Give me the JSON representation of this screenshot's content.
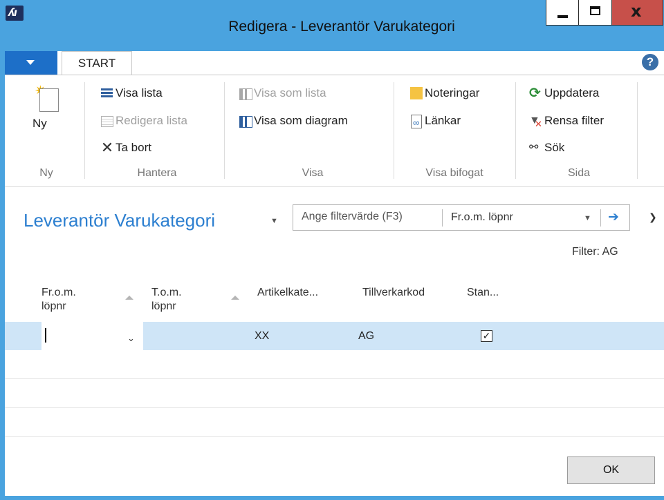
{
  "window": {
    "title": "Redigera - Leverantör Varukategori",
    "icons": [
      "app-logo-icon",
      "minimize-icon",
      "maximize-icon",
      "close-icon"
    ]
  },
  "ribbon": {
    "tab_start": "START",
    "groups": {
      "ny": {
        "label": "Ny",
        "new_label": "Ny"
      },
      "hantera": {
        "label": "Hantera",
        "visa_lista": "Visa lista",
        "redigera_lista": "Redigera lista",
        "ta_bort": "Ta bort"
      },
      "visa": {
        "label": "Visa",
        "visa_som_lista": "Visa som lista",
        "visa_som_diagram": "Visa som diagram"
      },
      "visa_bifogat": {
        "label": "Visa bifogat",
        "noteringar": "Noteringar",
        "lankar": "Länkar"
      },
      "sida": {
        "label": "Sida",
        "uppdatera": "Uppdatera",
        "rensa_filter": "Rensa filter",
        "sok": "Sök"
      }
    }
  },
  "page": {
    "title": "Leverantör Varukategori",
    "filter_placeholder": "Ange filtervärde (F3)",
    "filter_field": "Fr.o.m. löpnr",
    "filter_status": "Filter: AG"
  },
  "grid": {
    "headers": {
      "from_nr_1": "Fr.o.m.",
      "from_nr_2": "löpnr",
      "to_nr_1": "T.o.m.",
      "to_nr_2": "löpnr",
      "artikel": "Artikelkate...",
      "tillverkarkod": "Tillverkarkod",
      "standard": "Stan..."
    },
    "rows": [
      {
        "from_nr": "",
        "to_nr": "",
        "artikelkategori": "XX",
        "tillverkarkod": "AG",
        "standard": true
      }
    ]
  },
  "buttons": {
    "ok": "OK"
  },
  "colors": {
    "titlebar": "#4aa3df",
    "accent": "#2c7fd0",
    "selected_row": "#cfe5f7",
    "close": "#c7504a"
  }
}
